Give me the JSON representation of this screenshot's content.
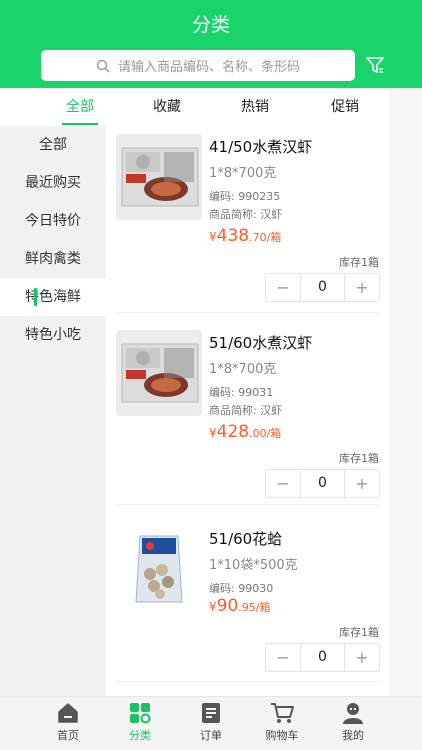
{
  "header": {
    "title": "分类",
    "search_placeholder": "请输入商品编码、名称、条形码"
  },
  "tabs": [
    {
      "label": "全部",
      "active": true
    },
    {
      "label": "收藏",
      "active": false
    },
    {
      "label": "热销",
      "active": false
    },
    {
      "label": "促销",
      "active": false
    }
  ],
  "sidebar": {
    "items": [
      {
        "label": "全部",
        "active": false
      },
      {
        "label": "最近购买",
        "active": false
      },
      {
        "label": "今日特价",
        "active": false
      },
      {
        "label": "鲜肉禽类",
        "active": false
      },
      {
        "label": "特色海鲜",
        "active": true
      },
      {
        "label": "特色小吃",
        "active": false
      }
    ]
  },
  "products": [
    {
      "name": "41/50水煮汉虾",
      "spec": "1*8*700克",
      "code": "编码: 990235",
      "abbr": "商品简称: 汉虾",
      "price_currency": "¥",
      "price_int": "438",
      "price_dec": ".70/箱",
      "stock": "库存1箱",
      "qty": "0",
      "minus": "−",
      "plus": "+"
    },
    {
      "name": "51/60水煮汉虾",
      "spec": "1*8*700克",
      "code": "编码: 99031",
      "abbr": "商品简称: 汉虾",
      "price_currency": "¥",
      "price_int": "428",
      "price_dec": ".00/箱",
      "stock": "库存1箱",
      "qty": "0",
      "minus": "−",
      "plus": "+"
    },
    {
      "name": "51/60花蛤",
      "spec": "1*10袋*500克",
      "code": "编码: 99030",
      "price_currency": "¥",
      "price_int": "90",
      "price_dec": ".95/箱",
      "stock": "库存1箱",
      "qty": "0",
      "minus": "−",
      "plus": "+"
    }
  ],
  "bottom_nav": [
    {
      "label": "首页",
      "icon": "home-icon",
      "active": false
    },
    {
      "label": "分类",
      "icon": "category-icon",
      "active": true
    },
    {
      "label": "订单",
      "icon": "order-icon",
      "active": false
    },
    {
      "label": "购物车",
      "icon": "cart-icon",
      "active": false
    },
    {
      "label": "我的",
      "icon": "profile-icon",
      "active": false
    }
  ],
  "colors": {
    "brand": "#19d46b",
    "accent": "#19c463",
    "price": "#ff5b24"
  }
}
